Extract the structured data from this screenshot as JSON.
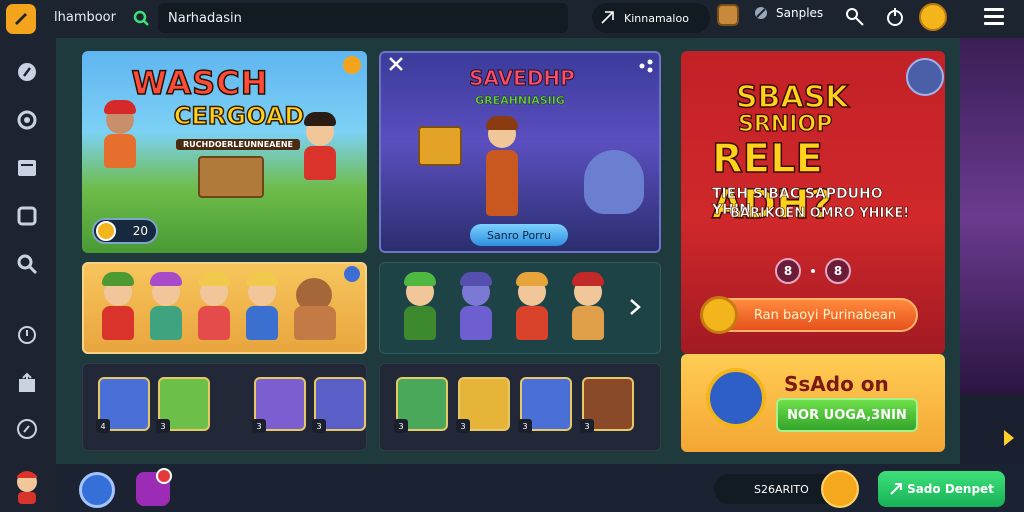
{
  "header": {
    "app_name": "lhamboor",
    "search_value": "Narhadasin",
    "user_label": "Kinnamaloo",
    "settings_label": "Sanples"
  },
  "cards": {
    "featured": {
      "title_line1": "WASCH",
      "title_line2": "CERGOAD",
      "subtitle": "RUCHDOERLEUNNEAENE",
      "count": "20"
    },
    "middle": {
      "title": "SAVEDHP",
      "subtitle": "GREAHNIASIIG",
      "button_label": "Sanro Porru"
    },
    "promo": {
      "line1": "SBASK",
      "line2": "SRNIOP",
      "line3": "RELE ADH?",
      "line4": "TIEH SIBAC SAPDUHO YHIN",
      "line5": "BARIKOEN OMRO YHIKE!",
      "nav_prev": "8",
      "nav_next": "8",
      "cta_label": "Ran baoyi Purinabean"
    },
    "secondary_promo": {
      "title": "SsAdo on",
      "button_label": "NOR UOGA,3NIN"
    },
    "tile_rows": {
      "left": [
        "4",
        "3",
        "3",
        "3"
      ],
      "right": [
        "3",
        "3",
        "3",
        "3"
      ]
    }
  },
  "footer": {
    "wallet_label": "S26ARITO",
    "deposit_label": "Sado Denpet"
  },
  "colors": {
    "accent_orange": "#f4a41c",
    "deposit_green": "#16b257",
    "promo_red": "#c22127"
  },
  "icons": {
    "sidebar": [
      "rocket-icon",
      "settings-icon",
      "cards-icon",
      "box-icon",
      "search-icon",
      "history-icon",
      "upload-icon",
      "compass-icon"
    ]
  }
}
